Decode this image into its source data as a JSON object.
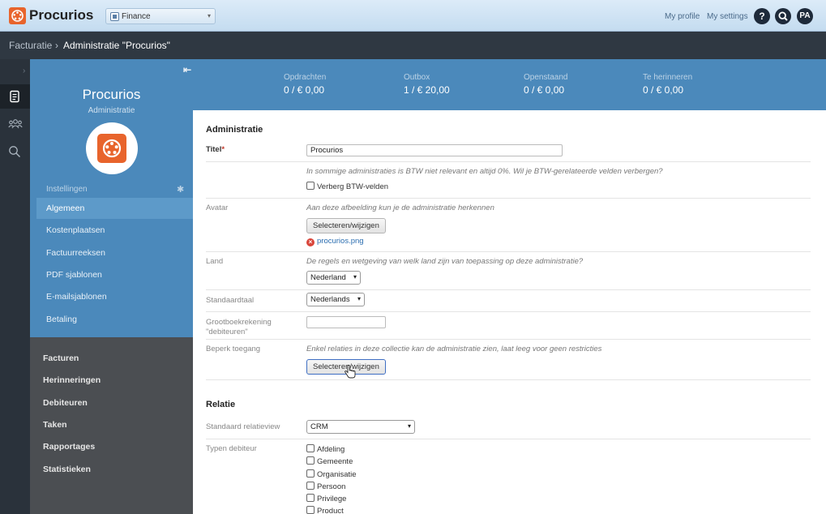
{
  "header": {
    "logo_text": "Procurios",
    "app_switcher_label": "Finance",
    "my_profile": "My profile",
    "my_settings": "My settings",
    "help_label": "?",
    "avatar_initials": "PA"
  },
  "breadcrumb": {
    "root": "Facturatie",
    "separator": "›",
    "current": "Administratie \"Procurios\""
  },
  "sidebar": {
    "name": "Procurios",
    "subtitle": "Administratie",
    "settings_heading": "Instellingen",
    "settings_items": [
      {
        "label": "Algemeen",
        "active": true
      },
      {
        "label": "Kostenplaatsen"
      },
      {
        "label": "Factuurreeksen"
      },
      {
        "label": "PDF sjablonen"
      },
      {
        "label": "E-mailsjablonen"
      },
      {
        "label": "Betaling"
      }
    ],
    "nav_items": [
      {
        "label": "Facturen"
      },
      {
        "label": "Herinneringen"
      },
      {
        "label": "Debiteuren"
      },
      {
        "label": "Taken"
      },
      {
        "label": "Rapportages"
      },
      {
        "label": "Statistieken"
      }
    ]
  },
  "stats": [
    {
      "label": "Opdrachten",
      "value": "0 / € 0,00"
    },
    {
      "label": "Outbox",
      "value": "1 / € 20,00"
    },
    {
      "label": "Openstaand",
      "value": "0 / € 0,00"
    },
    {
      "label": "Te herinneren",
      "value": "0 / € 0,00"
    }
  ],
  "form": {
    "section_admin": "Administratie",
    "titel": {
      "label": "Titel",
      "required_mark": "*",
      "value": "Procurios"
    },
    "btw": {
      "hint": "In sommige administraties is BTW niet relevant en altijd 0%. Wil je BTW-gerelateerde velden verbergen?",
      "checkbox_label": "Verberg BTW-velden"
    },
    "avatar": {
      "label": "Avatar",
      "hint": "Aan deze afbeelding kun je de administratie herkennen",
      "button_label": "Selecteren/wijzigen",
      "file_name": "procurios.png"
    },
    "land": {
      "label": "Land",
      "hint": "De regels en wetgeving van welk land zijn van toepassing op deze administratie?",
      "value": "Nederland"
    },
    "standaardtaal": {
      "label": "Standaardtaal",
      "value": "Nederlands"
    },
    "grootboek": {
      "label_line1": "Grootboekrekening",
      "label_line2": "\"debiteuren\"",
      "value": ""
    },
    "beperk": {
      "label": "Beperk toegang",
      "hint": "Enkel relaties in deze collectie kan de administratie zien, laat leeg voor geen restricties",
      "button_label": "Selecteren/wijzigen"
    },
    "section_relatie": "Relatie",
    "relatieview": {
      "label": "Standaard relatieview",
      "value": "CRM"
    },
    "typen": {
      "label": "Typen debiteur",
      "options": [
        "Afdeling",
        "Gemeente",
        "Organisatie",
        "Persoon",
        "Privilege",
        "Product"
      ]
    }
  }
}
